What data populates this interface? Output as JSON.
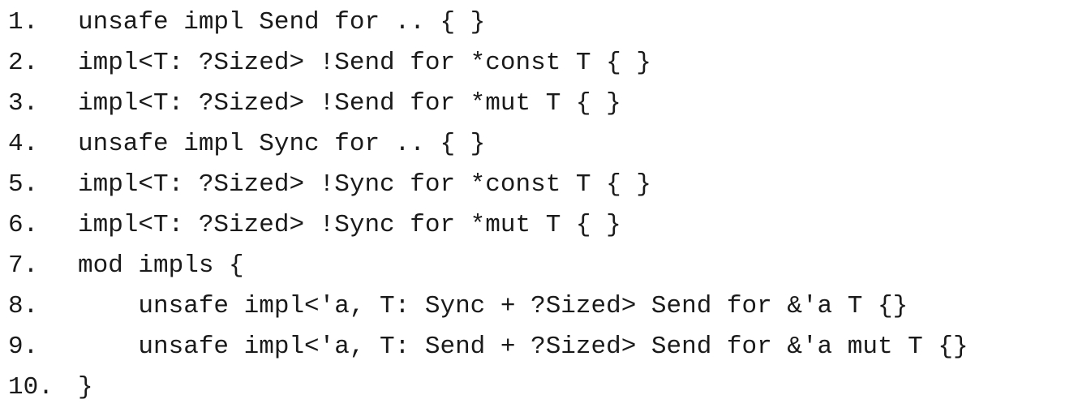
{
  "lines": [
    {
      "number": "1.",
      "code": "unsafe impl Send for .. { }"
    },
    {
      "number": "2.",
      "code": "impl<T: ?Sized> !Send for *const T { }"
    },
    {
      "number": "3.",
      "code": "impl<T: ?Sized> !Send for *mut T { }"
    },
    {
      "number": "4.",
      "code": "unsafe impl Sync for .. { }"
    },
    {
      "number": "5.",
      "code": "impl<T: ?Sized> !Sync for *const T { }"
    },
    {
      "number": "6.",
      "code": "impl<T: ?Sized> !Sync for *mut T { }"
    },
    {
      "number": "7.",
      "code": "mod impls {"
    },
    {
      "number": "8.",
      "code": "    unsafe impl<'a, T: Sync + ?Sized> Send for &'a T {}"
    },
    {
      "number": "9.",
      "code": "    unsafe impl<'a, T: Send + ?Sized> Send for &'a mut T {}"
    },
    {
      "number": "10.",
      "code": "}"
    }
  ]
}
